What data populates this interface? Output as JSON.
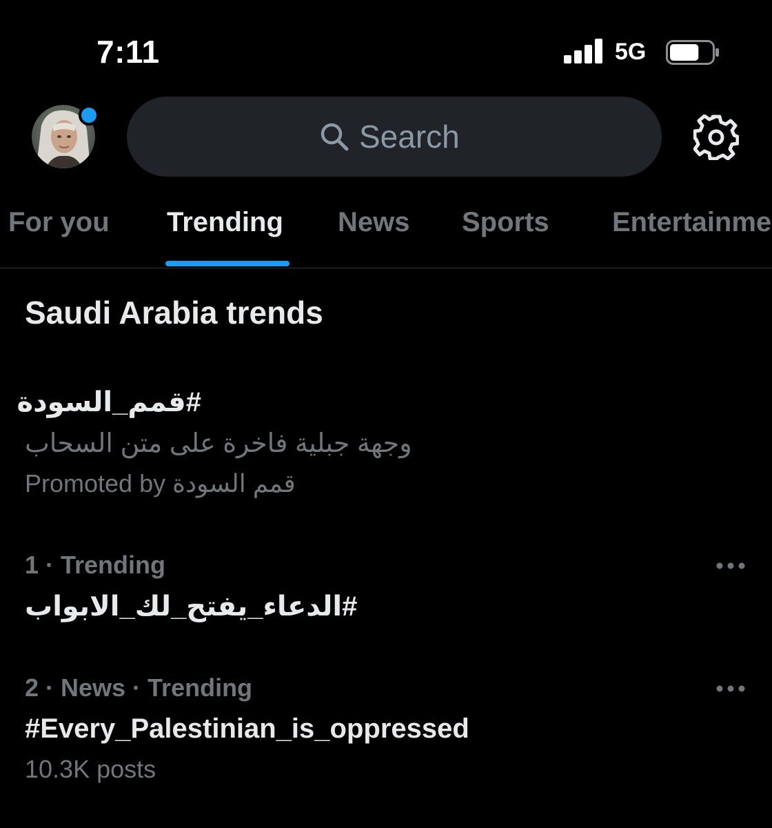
{
  "status_bar": {
    "time": "7:11",
    "network": "5G",
    "signal_bars": 4,
    "battery_level": 0.7
  },
  "header": {
    "search_placeholder": "Search",
    "notification_dot_color": "#1d9bf0"
  },
  "tabs": [
    {
      "label": "For you",
      "active": false
    },
    {
      "label": "Trending",
      "active": true
    },
    {
      "label": "News",
      "active": false
    },
    {
      "label": "Sports",
      "active": false
    },
    {
      "label": "Entertainment",
      "active": false
    }
  ],
  "section_title": "Saudi Arabia trends",
  "promoted": {
    "title": "#قمم_السودة",
    "description": "وجهة جبلية فاخرة على متن السحاب",
    "promoted_by_prefix": "Promoted by",
    "promoted_by_name": "قمم السودة"
  },
  "trends": [
    {
      "meta": "1 · Trending",
      "name": "#الدعاء_يفتح_لك_الابواب",
      "posts": ""
    },
    {
      "meta": "2 · News · Trending",
      "name": "#Every_Palestinian_is_oppressed",
      "posts": "10.3K posts"
    }
  ],
  "icons": {
    "search": "search-icon",
    "settings": "gear-icon",
    "more": "more-icon",
    "signal": "signal-icon",
    "battery": "battery-icon"
  },
  "colors": {
    "background": "#000000",
    "accent": "#1d9bf0",
    "secondary_text": "#71767b",
    "search_bg": "#202327"
  }
}
